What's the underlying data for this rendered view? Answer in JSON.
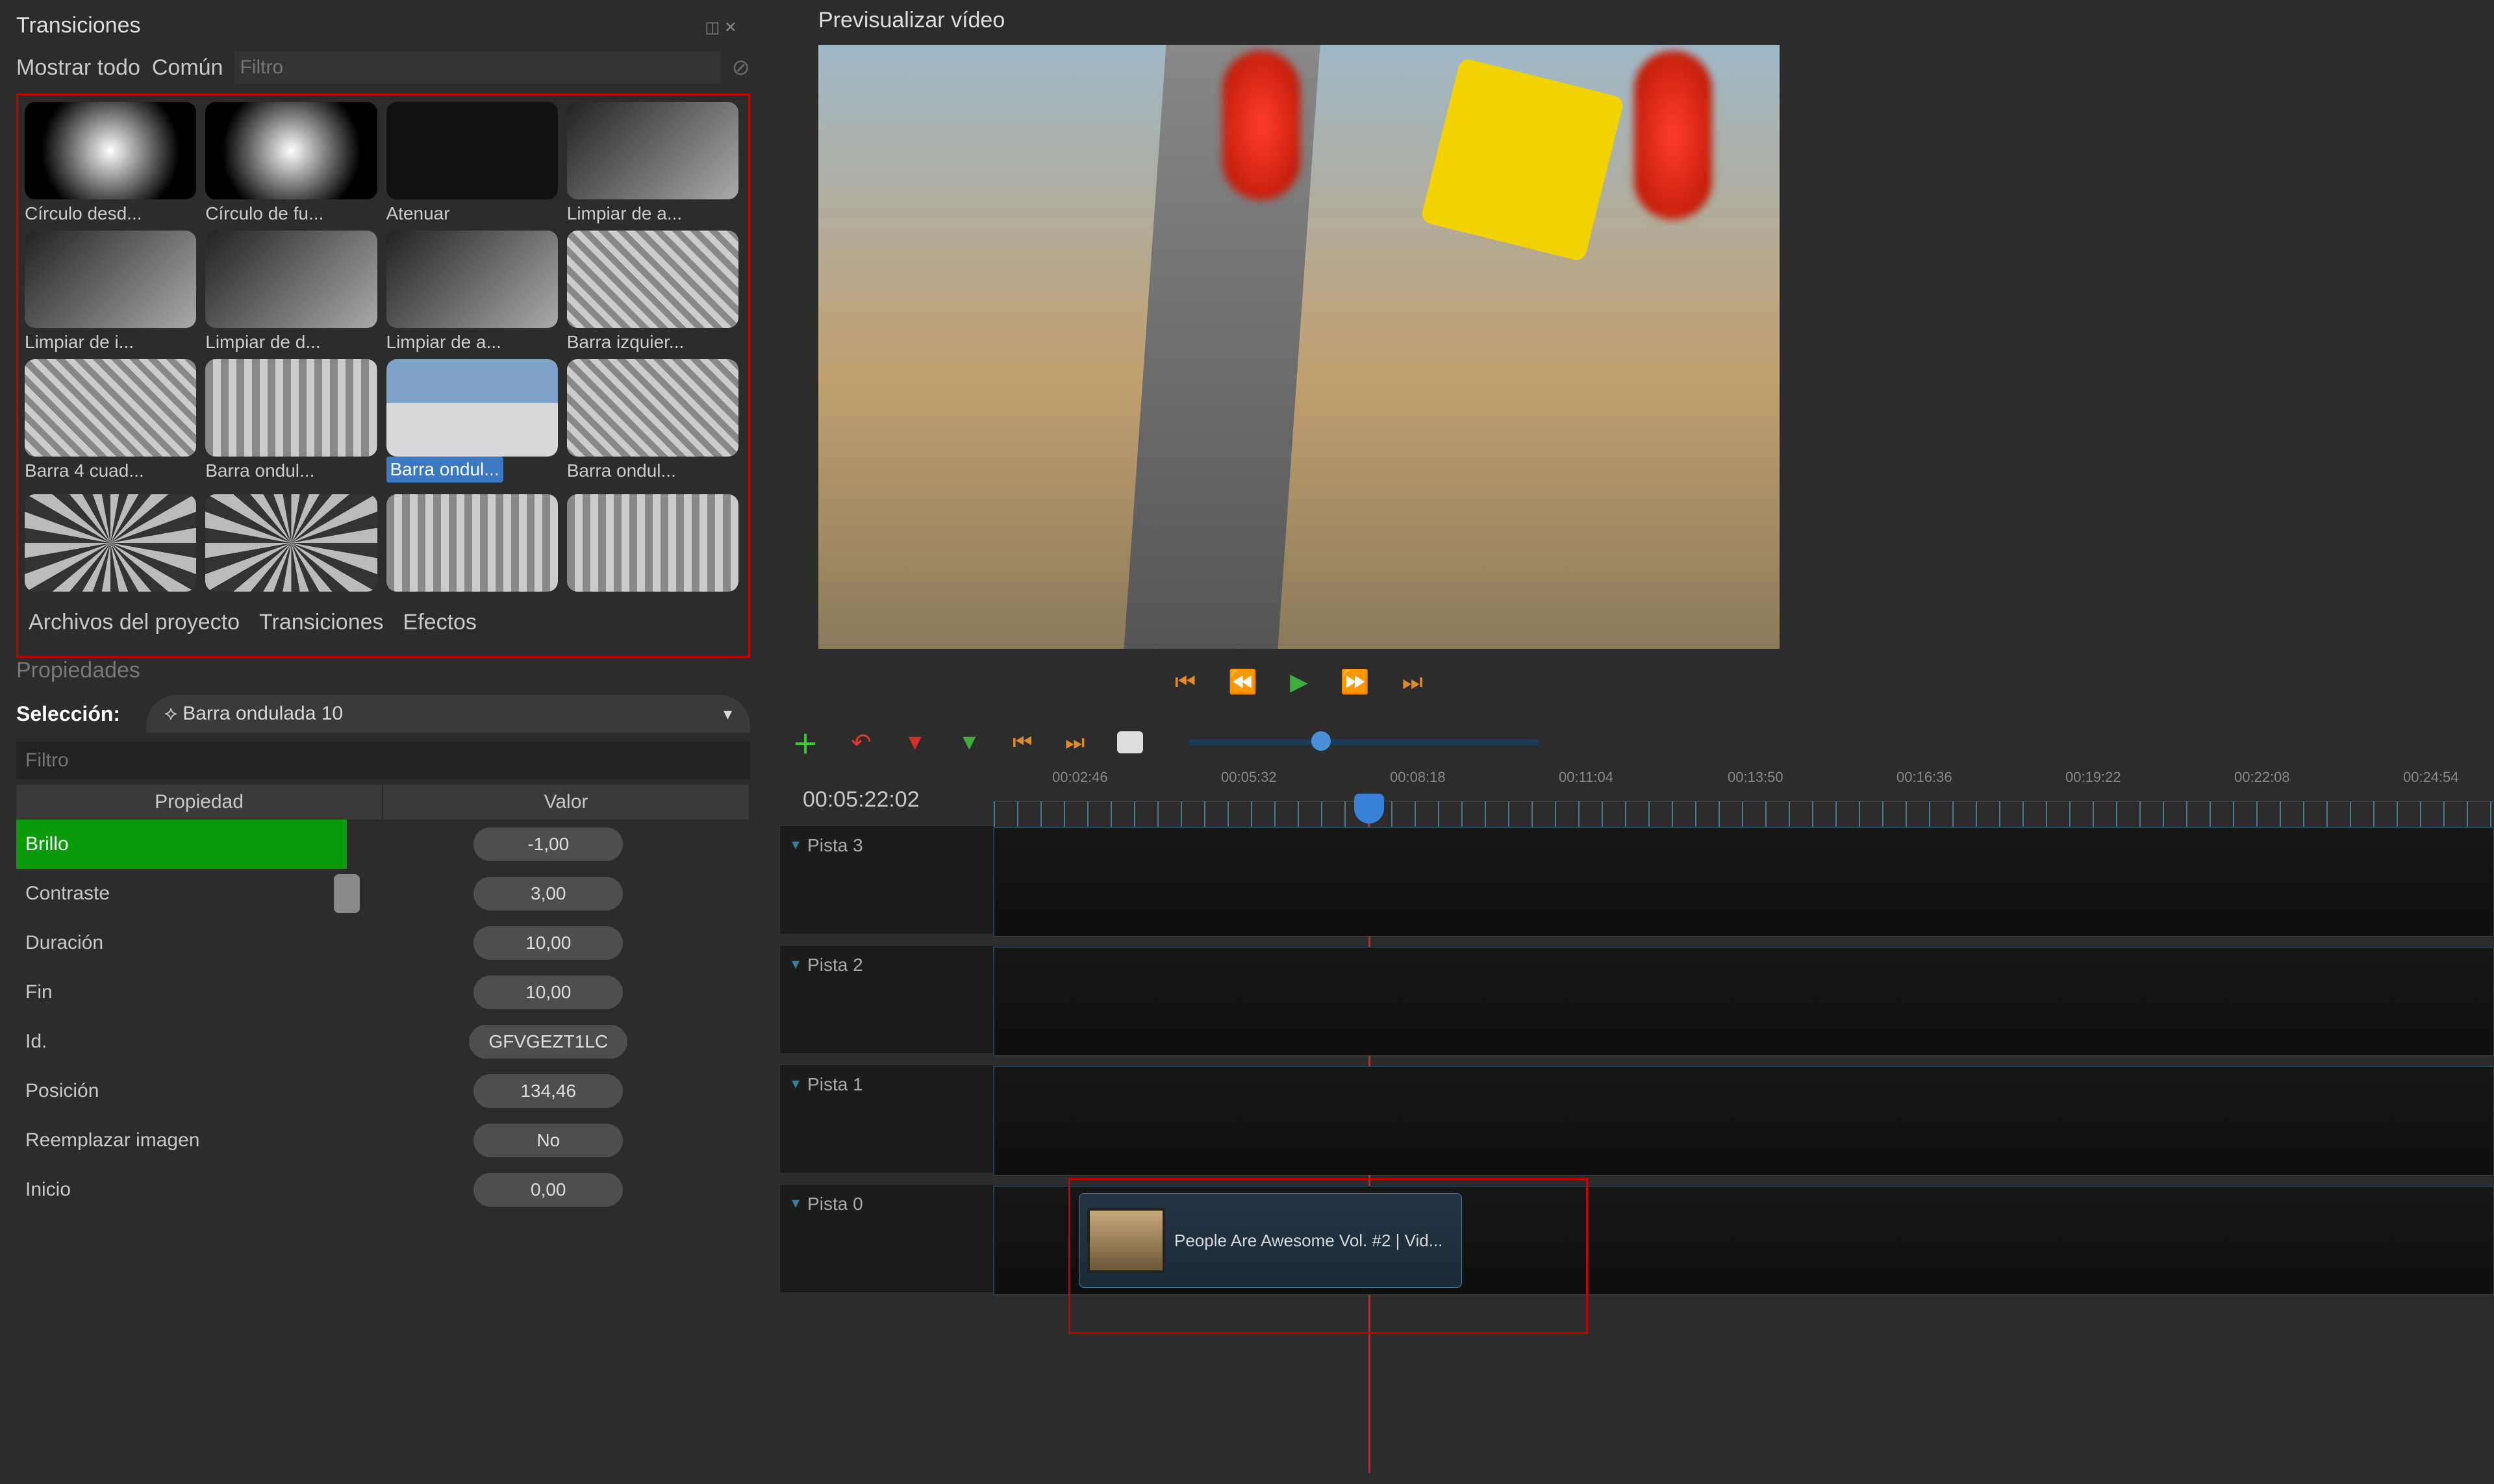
{
  "transitions": {
    "title": "Transiciones",
    "tab_all": "Mostrar todo",
    "tab_common": "Común",
    "filter_ph": "Filtro",
    "items": [
      {
        "label": "Círculo desd...",
        "style": "radial"
      },
      {
        "label": "Círculo de fu...",
        "style": "radial"
      },
      {
        "label": "Atenuar",
        "style": "dark"
      },
      {
        "label": "Limpiar de a...",
        "style": ""
      },
      {
        "label": "Limpiar de i...",
        "style": ""
      },
      {
        "label": "Limpiar de d...",
        "style": ""
      },
      {
        "label": "Limpiar de a...",
        "style": ""
      },
      {
        "label": "Barra izquier...",
        "style": "stripes"
      },
      {
        "label": "Barra 4 cuad...",
        "style": "stripes"
      },
      {
        "label": "Barra ondul...",
        "style": "vstripes"
      },
      {
        "label": "Barra ondul...",
        "style": "floor",
        "selected": true
      },
      {
        "label": "Barra ondul...",
        "style": "stripes"
      },
      {
        "label": "",
        "style": "fan"
      },
      {
        "label": "",
        "style": "fan"
      },
      {
        "label": "",
        "style": "vstripes"
      },
      {
        "label": "",
        "style": "vstripes"
      }
    ],
    "bottom_tabs": {
      "files": "Archivos del proyecto",
      "transitions": "Transiciones",
      "effects": "Efectos"
    }
  },
  "properties": {
    "title": "Propiedades",
    "selection_label": "Selección:",
    "selection_value": "Barra ondulada 10",
    "filter_ph": "Filtro",
    "col_prop": "Propiedad",
    "col_val": "Valor",
    "rows": [
      {
        "name": "Brillo",
        "value": "-1,00",
        "green": true
      },
      {
        "name": "Contraste",
        "value": "3,00",
        "slider": true
      },
      {
        "name": "Duración",
        "value": "10,00"
      },
      {
        "name": "Fin",
        "value": "10,00"
      },
      {
        "name": "Id.",
        "value": "GFVGEZT1LC"
      },
      {
        "name": "Posición",
        "value": "134,46"
      },
      {
        "name": "Reemplazar imagen",
        "value": "No"
      },
      {
        "name": "Inicio",
        "value": "0,00"
      }
    ]
  },
  "preview": {
    "title": "Previsualizar vídeo"
  },
  "timeline": {
    "timecode": "00:05:22:02",
    "ticks": [
      "00:02:46",
      "00:05:32",
      "00:08:18",
      "00:11:04",
      "00:13:50",
      "00:16:36",
      "00:19:22",
      "00:22:08",
      "00:24:54"
    ],
    "tracks": [
      "Pista 3",
      "Pista 2",
      "Pista 1",
      "Pista 0"
    ],
    "clip_label": "People Are Awesome Vol. #2 | Vid..."
  }
}
